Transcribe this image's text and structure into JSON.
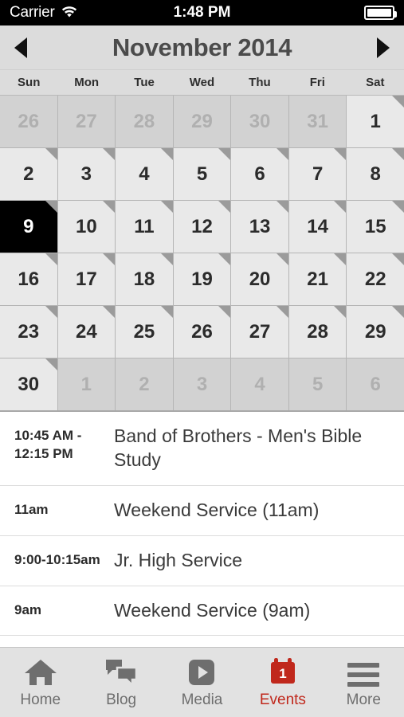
{
  "statusbar": {
    "carrier": "Carrier",
    "time": "1:48 PM",
    "wifi_icon": "wifi-icon",
    "battery_icon": "battery-full-icon"
  },
  "header": {
    "prev_label": "prev-month",
    "next_label": "next-month",
    "title": "November 2014"
  },
  "weekdays": [
    "Sun",
    "Mon",
    "Tue",
    "Wed",
    "Thu",
    "Fri",
    "Sat"
  ],
  "calendar": {
    "month": "November",
    "year": "2014",
    "selected_day": "9",
    "weeks": [
      [
        {
          "day": "26",
          "out": true,
          "event": false
        },
        {
          "day": "27",
          "out": true,
          "event": false
        },
        {
          "day": "28",
          "out": true,
          "event": false
        },
        {
          "day": "29",
          "out": true,
          "event": false
        },
        {
          "day": "30",
          "out": true,
          "event": false
        },
        {
          "day": "31",
          "out": true,
          "event": false
        },
        {
          "day": "1",
          "out": false,
          "event": true
        }
      ],
      [
        {
          "day": "2",
          "out": false,
          "event": true
        },
        {
          "day": "3",
          "out": false,
          "event": true
        },
        {
          "day": "4",
          "out": false,
          "event": true
        },
        {
          "day": "5",
          "out": false,
          "event": true
        },
        {
          "day": "6",
          "out": false,
          "event": true
        },
        {
          "day": "7",
          "out": false,
          "event": true
        },
        {
          "day": "8",
          "out": false,
          "event": true
        }
      ],
      [
        {
          "day": "9",
          "out": false,
          "event": true,
          "selected": true
        },
        {
          "day": "10",
          "out": false,
          "event": true
        },
        {
          "day": "11",
          "out": false,
          "event": true
        },
        {
          "day": "12",
          "out": false,
          "event": true
        },
        {
          "day": "13",
          "out": false,
          "event": true
        },
        {
          "day": "14",
          "out": false,
          "event": true
        },
        {
          "day": "15",
          "out": false,
          "event": true
        }
      ],
      [
        {
          "day": "16",
          "out": false,
          "event": true
        },
        {
          "day": "17",
          "out": false,
          "event": true
        },
        {
          "day": "18",
          "out": false,
          "event": true
        },
        {
          "day": "19",
          "out": false,
          "event": true
        },
        {
          "day": "20",
          "out": false,
          "event": true
        },
        {
          "day": "21",
          "out": false,
          "event": true
        },
        {
          "day": "22",
          "out": false,
          "event": true
        }
      ],
      [
        {
          "day": "23",
          "out": false,
          "event": true
        },
        {
          "day": "24",
          "out": false,
          "event": true
        },
        {
          "day": "25",
          "out": false,
          "event": true
        },
        {
          "day": "26",
          "out": false,
          "event": true
        },
        {
          "day": "27",
          "out": false,
          "event": true
        },
        {
          "day": "28",
          "out": false,
          "event": true
        },
        {
          "day": "29",
          "out": false,
          "event": true
        }
      ],
      [
        {
          "day": "30",
          "out": false,
          "event": true
        },
        {
          "day": "1",
          "out": true,
          "event": false
        },
        {
          "day": "2",
          "out": true,
          "event": false
        },
        {
          "day": "3",
          "out": true,
          "event": false
        },
        {
          "day": "4",
          "out": true,
          "event": false
        },
        {
          "day": "5",
          "out": true,
          "event": false
        },
        {
          "day": "6",
          "out": true,
          "event": false
        }
      ]
    ]
  },
  "events": [
    {
      "time": "10:45 AM - 12:15 PM",
      "title": "Band of Brothers - Men's Bible Study"
    },
    {
      "time": "11am",
      "title": "Weekend Service (11am)"
    },
    {
      "time": "9:00-10:15am",
      "title": "Jr. High Service"
    },
    {
      "time": "9am",
      "title": "Weekend Service (9am)"
    }
  ],
  "tabbar": {
    "items": [
      {
        "label": "Home",
        "icon": "home-icon",
        "active": false
      },
      {
        "label": "Blog",
        "icon": "chat-icon",
        "active": false
      },
      {
        "label": "Media",
        "icon": "play-icon",
        "active": false
      },
      {
        "label": "Events",
        "icon": "calendar-icon",
        "active": true,
        "badge": "1"
      },
      {
        "label": "More",
        "icon": "hamburger-icon",
        "active": false
      }
    ]
  },
  "colors": {
    "accent_red": "#c0281c",
    "cell_bg": "#e9e9e9",
    "cell_out_bg": "#d2d2d2",
    "selected_bg": "#000000",
    "header_bg": "#dcdcdc",
    "tabbar_bg": "#e2e2e2"
  }
}
